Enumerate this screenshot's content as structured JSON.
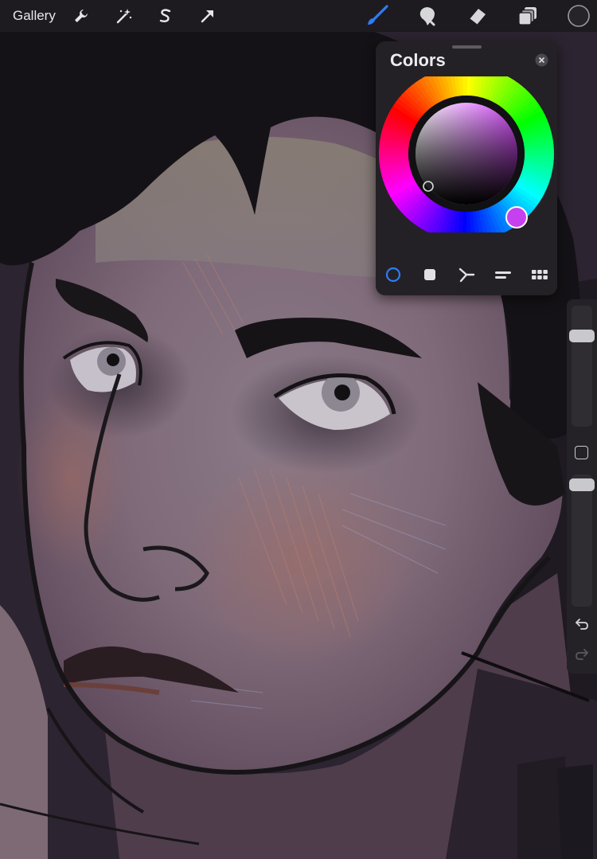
{
  "topbar": {
    "gallery_label": "Gallery",
    "left_tools": [
      "wrench-icon",
      "magic-wand-icon",
      "selection-s-icon",
      "arrow-cursor-icon"
    ],
    "right_tools": [
      "brush-icon",
      "smudge-icon",
      "eraser-icon",
      "layers-icon",
      "color-swatch"
    ],
    "active_tool": "brush-icon",
    "current_color": "#262428",
    "accent_color": "#2f7cf6"
  },
  "colors_panel": {
    "title": "Colors",
    "mode": "disc",
    "tabs": [
      "disc",
      "classic",
      "harmony",
      "value",
      "palettes"
    ],
    "selected_hue": "#d84cff",
    "selected_color": "#262428"
  },
  "sidebar": {
    "brush_size": 0.78,
    "opacity": 0.97,
    "undo_icon": "undo-icon",
    "redo_icon": "redo-icon"
  }
}
